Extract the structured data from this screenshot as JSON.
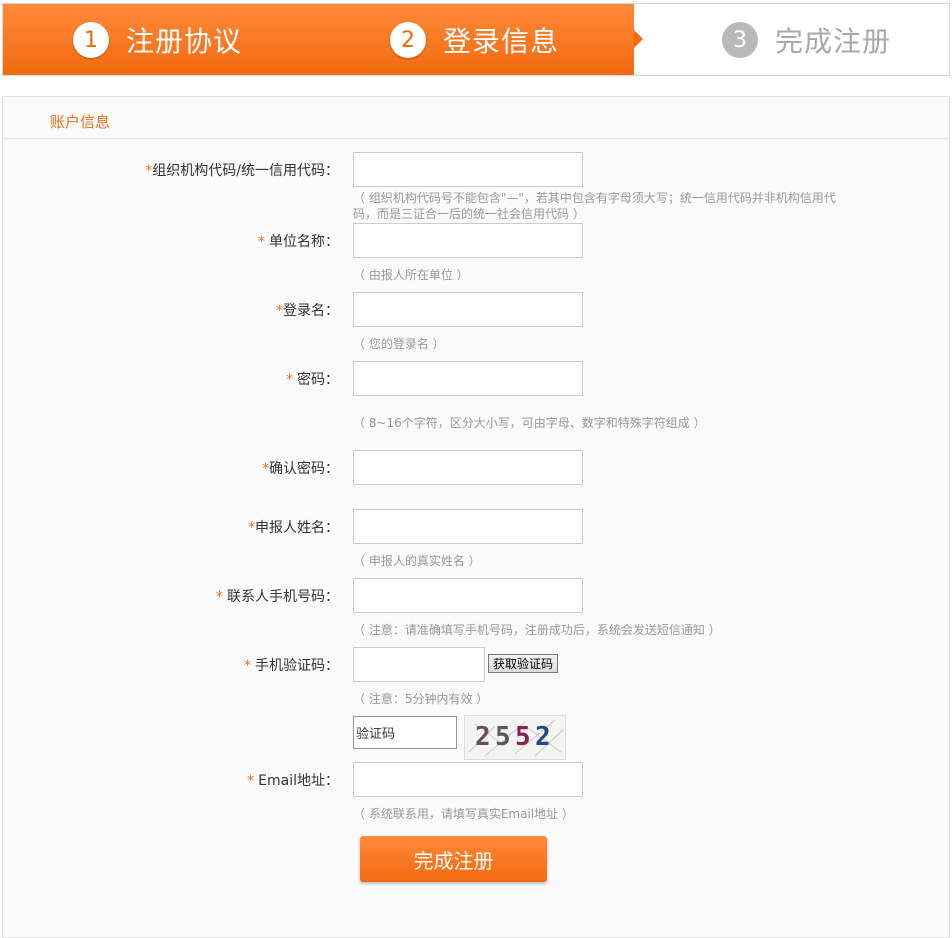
{
  "steps": [
    {
      "num": "1",
      "label": "注册协议",
      "state": "done"
    },
    {
      "num": "2",
      "label": "登录信息",
      "state": "current"
    },
    {
      "num": "3",
      "label": "完成注册",
      "state": "todo"
    }
  ],
  "section_title": "账户信息",
  "required_mark": "*",
  "fields": {
    "org_code": {
      "label": "组织机构代码/统一信用代码：",
      "hint": "（ 组织机构代码号不能包含\"—\"，若其中包含有字母须大写；统一信用代码并非机构信用代码，而是三证合一后的统一社会信用代码 ）"
    },
    "unit_name": {
      "label": "单位名称：",
      "hint": "（ 由报人所在单位 ）"
    },
    "login_name": {
      "label": "登录名：",
      "hint": "（ 您的登录名 ）"
    },
    "password": {
      "label": "密码：",
      "hint": "（ 8~16个字符，区分大小写，可由字母、数字和特殊字符组成 ）"
    },
    "confirm_password": {
      "label": "确认密码："
    },
    "applicant_name": {
      "label": "申报人姓名：",
      "hint": "（ 申报人的真实姓名 ）"
    },
    "contact_phone": {
      "label": "联系人手机号码：",
      "hint": "（ 注意：请准确填写手机号码，注册成功后，系统会发送短信通知 ）"
    },
    "sms_code": {
      "label": "手机验证码：",
      "hint": "（ 注意：5分钟内有效 ）",
      "button": "获取验证码"
    },
    "captcha": {
      "placeholder": "验证码",
      "image_text": [
        "2",
        "5",
        "5",
        "2"
      ]
    },
    "email": {
      "label": "Email地址：",
      "hint": "（ 系统联系用，请填写真实Email地址 ）"
    }
  },
  "submit_label": "完成注册",
  "colors": {
    "accent": "#f26a0f",
    "section_title": "#e8731e",
    "hint": "#999999"
  }
}
